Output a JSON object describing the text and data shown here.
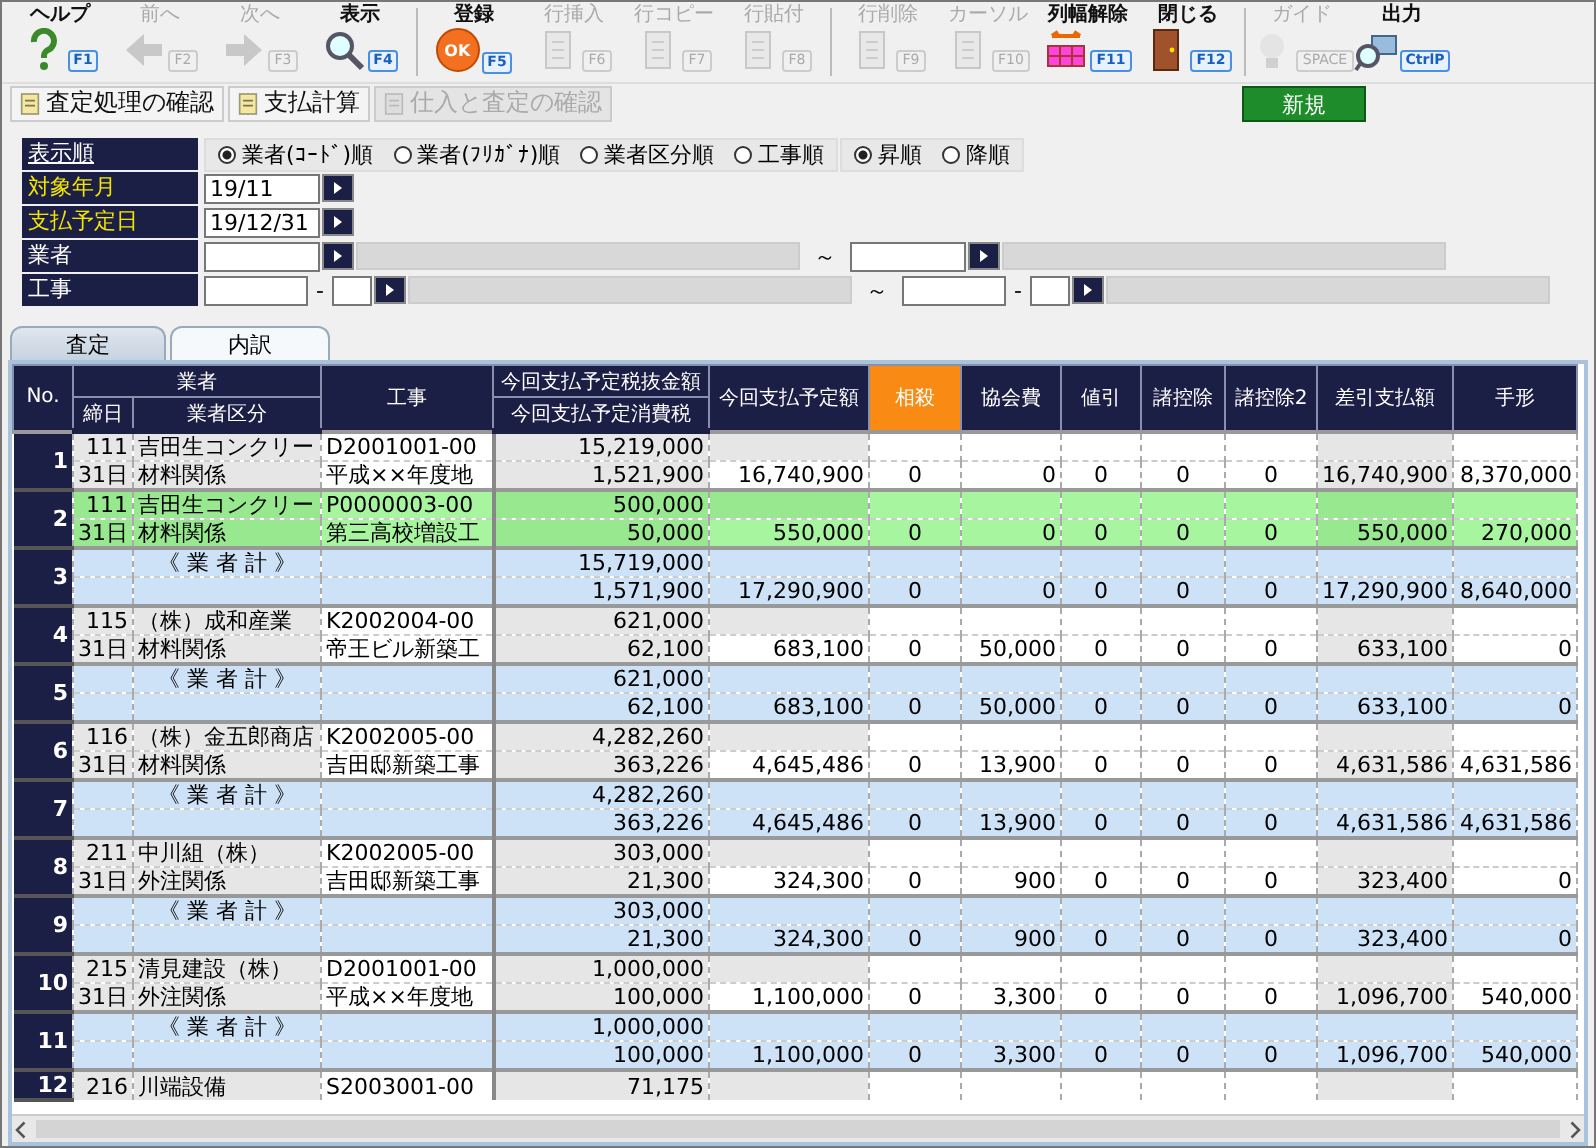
{
  "toolbar": [
    [
      {
        "label": "ヘルプ",
        "key": "F1",
        "disabled": false
      },
      {
        "label": "前へ",
        "key": "F2",
        "disabled": true
      },
      {
        "label": "次へ",
        "key": "F3",
        "disabled": true
      },
      {
        "label": "表示",
        "key": "F4",
        "disabled": false
      }
    ],
    [
      {
        "label": "登録",
        "key": "F5",
        "disabled": false,
        "icon_text": "OK"
      },
      {
        "label": "行挿入",
        "key": "F6",
        "disabled": true
      },
      {
        "label": "行コピー",
        "key": "F7",
        "disabled": true
      },
      {
        "label": "行貼付",
        "key": "F8",
        "disabled": true
      }
    ],
    [
      {
        "label": "行削除",
        "key": "F9",
        "disabled": true
      },
      {
        "label": "カーソル",
        "key": "F10",
        "disabled": true
      },
      {
        "label": "列幅解除",
        "key": "F11",
        "disabled": false
      },
      {
        "label": "閉じる",
        "key": "F12",
        "disabled": false
      }
    ],
    [
      {
        "label": "ガイド",
        "key": "SPACE",
        "disabled": true
      },
      {
        "label": "出力",
        "key": "CtrlP",
        "disabled": false
      }
    ]
  ],
  "sub_actions": [
    {
      "label": "査定処理の確認",
      "disabled": false
    },
    {
      "label": "支払計算",
      "disabled": false
    },
    {
      "label": "仕入と査定の確認",
      "disabled": true
    }
  ],
  "new_button": "新規",
  "filters": {
    "sort": {
      "label": "表示順",
      "options": [
        {
          "label": "業者(ｺｰﾄﾞ)順",
          "selected": true
        },
        {
          "label": "業者(ﾌﾘｶﾞﾅ)順",
          "selected": false
        },
        {
          "label": "業者区分順",
          "selected": false
        },
        {
          "label": "工事順",
          "selected": false
        }
      ],
      "direction": [
        {
          "label": "昇順",
          "selected": true
        },
        {
          "label": "降順",
          "selected": false
        }
      ]
    },
    "target_month": {
      "label": "対象年月",
      "required": true,
      "value": "19/11"
    },
    "payment_date": {
      "label": "支払予定日",
      "required": true,
      "value": "19/12/31"
    },
    "vendor": {
      "label": "業者",
      "required": false,
      "separator": "～"
    },
    "job": {
      "label": "工事",
      "required": false,
      "dash_from": "-",
      "separator": "～",
      "dash_to": "-"
    }
  },
  "tabs": [
    {
      "label": "査定",
      "selected": false
    },
    {
      "label": "内訳",
      "selected": true
    }
  ],
  "table": {
    "header": {
      "no": "No.",
      "vendor": "業者",
      "closing_day": "締日",
      "category": "業者区分",
      "job": "工事",
      "tax_excl": "今回支払予定税抜金額",
      "tax": "今回支払予定消費税",
      "amount_columns": [
        {
          "label": "今回支払予定額",
          "highlighted": false
        },
        {
          "label": "相殺",
          "highlighted": true
        },
        {
          "label": "協会費",
          "highlighted": false
        },
        {
          "label": "値引",
          "highlighted": false
        },
        {
          "label": "諸控除",
          "highlighted": false
        },
        {
          "label": "諸控除2",
          "highlighted": false
        },
        {
          "label": "差引支払額",
          "highlighted": false
        },
        {
          "label": "手形",
          "highlighted": false
        }
      ]
    },
    "rows": [
      {
        "no": "1",
        "kind": "detail",
        "selected": false,
        "code": "111",
        "vendor": "吉田生コンクリー",
        "job_code": "D2001001-00",
        "tax_excl": "15,219,000",
        "day": "31日",
        "category": "材料関係",
        "job_name": "平成××年度地",
        "tax": "1,521,900",
        "amounts": [
          "16,740,900",
          "0",
          "0",
          "0",
          "0",
          "0",
          "16,740,900",
          "8,370,000"
        ]
      },
      {
        "no": "2",
        "kind": "detail",
        "selected": true,
        "code": "111",
        "vendor": "吉田生コンクリー",
        "job_code": "P0000003-00",
        "tax_excl": "500,000",
        "day": "31日",
        "category": "材料関係",
        "job_name": "第三高校増設工",
        "tax": "50,000",
        "amounts": [
          "550,000",
          "0",
          "0",
          "0",
          "0",
          "0",
          "550,000",
          "270,000"
        ]
      },
      {
        "no": "3",
        "kind": "subtotal",
        "selected": false,
        "vendor": "《 業 者 計 》",
        "tax_excl": "15,719,000",
        "tax": "1,571,900",
        "amounts": [
          "17,290,900",
          "0",
          "0",
          "0",
          "0",
          "0",
          "17,290,900",
          "8,640,000"
        ]
      },
      {
        "no": "4",
        "kind": "detail",
        "selected": false,
        "code": "115",
        "vendor": "（株）成和産業",
        "job_code": "K2002004-00",
        "tax_excl": "621,000",
        "day": "31日",
        "category": "材料関係",
        "job_name": "帝王ビル新築工",
        "tax": "62,100",
        "amounts": [
          "683,100",
          "0",
          "50,000",
          "0",
          "0",
          "0",
          "633,100",
          "0"
        ]
      },
      {
        "no": "5",
        "kind": "subtotal",
        "selected": false,
        "vendor": "《 業 者 計 》",
        "tax_excl": "621,000",
        "tax": "62,100",
        "amounts": [
          "683,100",
          "0",
          "50,000",
          "0",
          "0",
          "0",
          "633,100",
          "0"
        ]
      },
      {
        "no": "6",
        "kind": "detail",
        "selected": false,
        "code": "116",
        "vendor": "（株）金五郎商店",
        "job_code": "K2002005-00",
        "tax_excl": "4,282,260",
        "day": "31日",
        "category": "材料関係",
        "job_name": "吉田邸新築工事",
        "tax": "363,226",
        "amounts": [
          "4,645,486",
          "0",
          "13,900",
          "0",
          "0",
          "0",
          "4,631,586",
          "4,631,586"
        ]
      },
      {
        "no": "7",
        "kind": "subtotal",
        "selected": false,
        "vendor": "《 業 者 計 》",
        "tax_excl": "4,282,260",
        "tax": "363,226",
        "amounts": [
          "4,645,486",
          "0",
          "13,900",
          "0",
          "0",
          "0",
          "4,631,586",
          "4,631,586"
        ]
      },
      {
        "no": "8",
        "kind": "detail",
        "selected": false,
        "code": "211",
        "vendor": "中川組（株）",
        "job_code": "K2002005-00",
        "tax_excl": "303,000",
        "day": "31日",
        "category": "外注関係",
        "job_name": "吉田邸新築工事",
        "tax": "21,300",
        "amounts": [
          "324,300",
          "0",
          "900",
          "0",
          "0",
          "0",
          "323,400",
          "0"
        ]
      },
      {
        "no": "9",
        "kind": "subtotal",
        "selected": false,
        "vendor": "《 業 者 計 》",
        "tax_excl": "303,000",
        "tax": "21,300",
        "amounts": [
          "324,300",
          "0",
          "900",
          "0",
          "0",
          "0",
          "323,400",
          "0"
        ]
      },
      {
        "no": "10",
        "kind": "detail",
        "selected": false,
        "code": "215",
        "vendor": "清見建設（株）",
        "job_code": "D2001001-00",
        "tax_excl": "1,000,000",
        "day": "31日",
        "category": "外注関係",
        "job_name": "平成××年度地",
        "tax": "100,000",
        "amounts": [
          "1,100,000",
          "0",
          "3,300",
          "0",
          "0",
          "0",
          "1,096,700",
          "540,000"
        ]
      },
      {
        "no": "11",
        "kind": "subtotal",
        "selected": false,
        "vendor": "《 業 者 計 》",
        "tax_excl": "1,000,000",
        "tax": "100,000",
        "amounts": [
          "1,100,000",
          "0",
          "3,300",
          "0",
          "0",
          "0",
          "1,096,700",
          "540,000"
        ]
      },
      {
        "no": "12",
        "kind": "detail",
        "selected": false,
        "code": "216",
        "vendor": "川端設備",
        "job_code": "S2003001-00",
        "tax_excl": "71,175"
      }
    ]
  }
}
